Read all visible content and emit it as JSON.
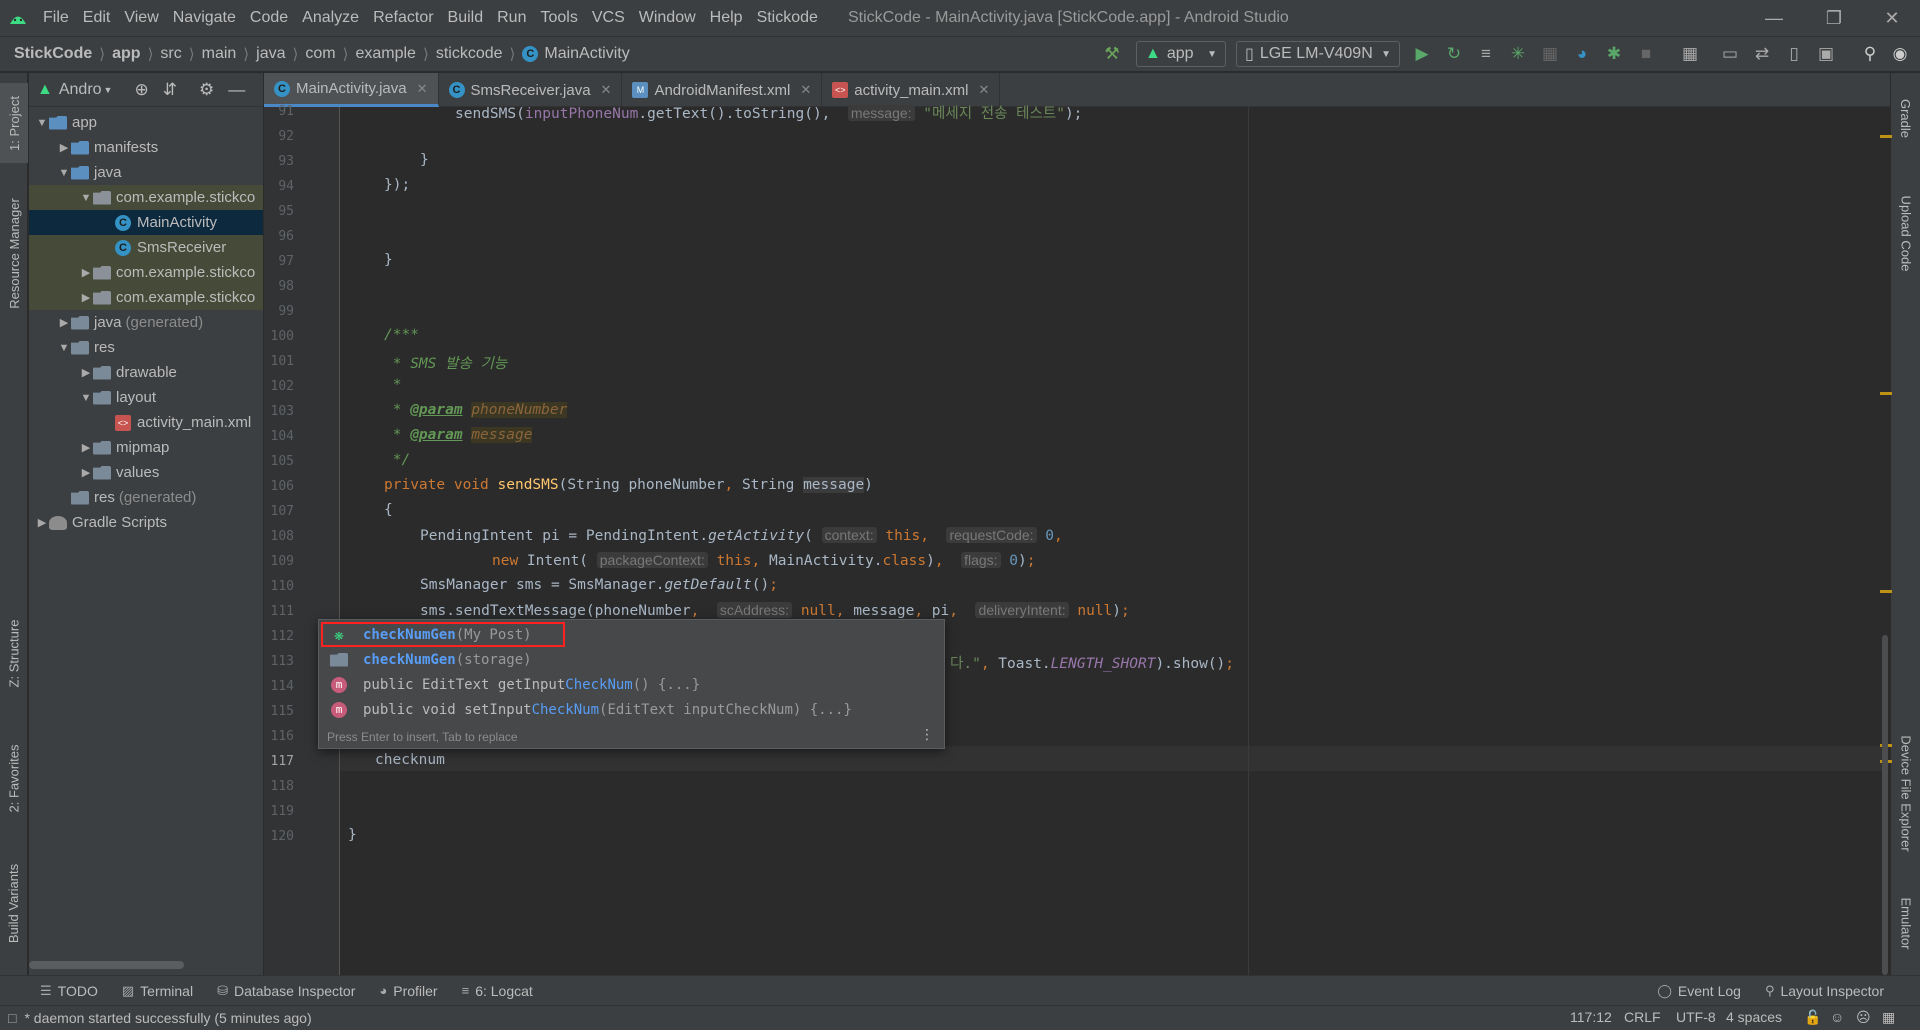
{
  "menubar": {
    "items": [
      "File",
      "Edit",
      "View",
      "Navigate",
      "Code",
      "Analyze",
      "Refactor",
      "Build",
      "Run",
      "Tools",
      "VCS",
      "Window",
      "Help",
      "Stickode"
    ],
    "window_title": "StickCode - MainActivity.java [StickCode.app] - Android Studio"
  },
  "navbar": {
    "breadcrumbs": [
      "StickCode",
      "app",
      "src",
      "main",
      "java",
      "com",
      "example",
      "stickcode",
      "MainActivity"
    ],
    "run_config": "app",
    "device": "LGE LM-V409N"
  },
  "project_panel": {
    "title": "Andro",
    "tree": [
      {
        "label": "app",
        "level": 0,
        "expanded": true,
        "icon": "module-folder-icon"
      },
      {
        "label": "manifests",
        "level": 1,
        "expanded": false,
        "icon": "folder-icon"
      },
      {
        "label": "java",
        "level": 1,
        "expanded": true,
        "icon": "folder-icon"
      },
      {
        "label": "com.example.stickco",
        "level": 2,
        "expanded": true,
        "icon": "package-icon"
      },
      {
        "label": "MainActivity",
        "level": 3,
        "icon": "class-icon",
        "selected": true
      },
      {
        "label": "SmsReceiver",
        "level": 3,
        "icon": "class-icon"
      },
      {
        "label": "com.example.stickco",
        "level": 2,
        "expanded": false,
        "icon": "package-icon"
      },
      {
        "label": "com.example.stickco",
        "level": 2,
        "expanded": false,
        "icon": "package-icon"
      },
      {
        "label": "java",
        "suffix": "(generated)",
        "level": 1,
        "expanded": false,
        "icon": "folder-icon"
      },
      {
        "label": "res",
        "level": 1,
        "expanded": true,
        "icon": "folder-icon"
      },
      {
        "label": "drawable",
        "level": 2,
        "expanded": false,
        "icon": "folder-icon"
      },
      {
        "label": "layout",
        "level": 2,
        "expanded": true,
        "icon": "folder-icon"
      },
      {
        "label": "activity_main.xml",
        "level": 3,
        "icon": "xml-icon"
      },
      {
        "label": "mipmap",
        "level": 2,
        "expanded": false,
        "icon": "folder-icon"
      },
      {
        "label": "values",
        "level": 2,
        "expanded": false,
        "icon": "folder-icon"
      },
      {
        "label": "res",
        "suffix": "(generated)",
        "level": 1,
        "icon": "folder-icon"
      },
      {
        "label": "Gradle Scripts",
        "level": 0,
        "expanded": false,
        "icon": "gradle-icon"
      }
    ]
  },
  "tabs": [
    {
      "label": "MainActivity.java",
      "active": true,
      "icon": "class-icon"
    },
    {
      "label": "SmsReceiver.java",
      "active": false,
      "icon": "class-icon"
    },
    {
      "label": "AndroidManifest.xml",
      "active": false,
      "icon": "manifest-icon"
    },
    {
      "label": "activity_main.xml",
      "active": false,
      "icon": "xml-icon"
    }
  ],
  "editor": {
    "line_numbers": [
      "91",
      "92",
      "93",
      "94",
      "95",
      "96",
      "97",
      "98",
      "99",
      "100",
      "101",
      "102",
      "103",
      "104",
      "105",
      "106",
      "107",
      "108",
      "109",
      "110",
      "111",
      "112",
      "113",
      "114",
      "115",
      "116",
      "117",
      "118",
      "119",
      "120"
    ],
    "current_line": "117",
    "typed_text": "checknum"
  },
  "completion": {
    "items": [
      {
        "match": "checkNumGen",
        "rest": "(My Post)",
        "icon": "stickode-icon",
        "selected": true
      },
      {
        "match": "checkNumGen",
        "rest": "(storage)",
        "icon": "folder-icon"
      },
      {
        "prefix": "public EditText getInput",
        "match": "CheckNum",
        "rest": "() {...}",
        "icon": "method-icon"
      },
      {
        "prefix": "public void setInput",
        "match": "CheckNum",
        "rest": "(EditText inputCheckNum) {...}",
        "icon": "method-icon"
      }
    ],
    "footer": "Press Enter to insert, Tab to replace"
  },
  "left_tool_tabs": [
    "1: Project",
    "Resource Manager",
    "Z: Structure",
    "2: Favorites",
    "Build Variants"
  ],
  "right_tool_tabs": [
    "Gradle",
    "Upload Code",
    "Device File Explorer",
    "Emulator"
  ],
  "bottom_tools": [
    "TODO",
    "Terminal",
    "Database Inspector",
    "Profiler",
    "6: Logcat",
    "Event Log",
    "Layout Inspector"
  ],
  "status": {
    "message": "* daemon started successfully (5 minutes ago)",
    "position": "117:12",
    "line_sep": "CRLF",
    "encoding": "UTF-8",
    "indent": "4 spaces"
  },
  "colors": {
    "accent": "#4a88c7",
    "keyword": "#cc7832",
    "string": "#6a8759",
    "highlight_box": "#ff2020"
  }
}
